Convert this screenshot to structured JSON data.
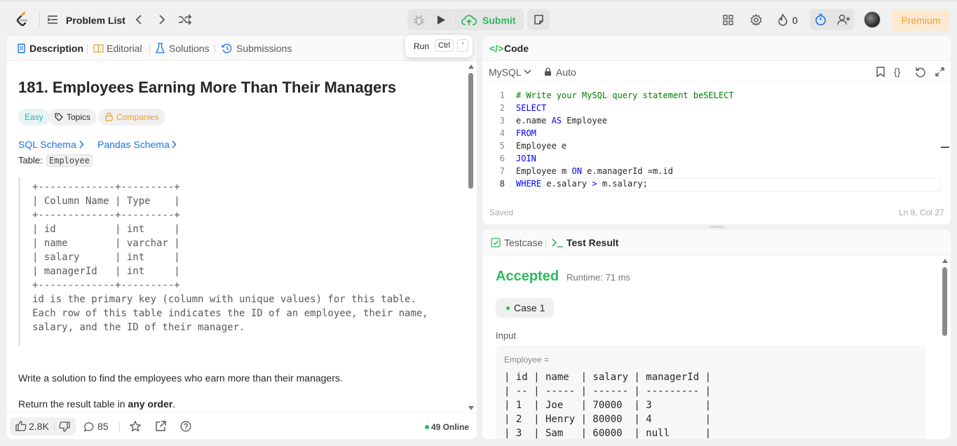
{
  "topbar": {
    "problem_list": "Problem List",
    "submit": "Submit",
    "streak": "0",
    "premium": "Premium"
  },
  "tooltip": {
    "run": "Run",
    "key1": "Ctrl",
    "key2": "'"
  },
  "left_tabs": [
    "Description",
    "Editorial",
    "Solutions",
    "Submissions"
  ],
  "problem": {
    "title": "181. Employees Earning More Than Their Managers",
    "difficulty": "Easy",
    "topics": "Topics",
    "companies": "Companies",
    "sql_schema": "SQL Schema",
    "pandas_schema": "Pandas Schema",
    "table_label": "Table:",
    "table_name": "Employee",
    "schema_lines": [
      "+-------------+---------+",
      "| Column Name | Type    |",
      "+-------------+---------+",
      "| id          | int     |",
      "| name        | varchar |",
      "| salary      | int     |",
      "| managerId   | int     |",
      "+-------------+---------+",
      "id is the primary key (column with unique values) for this table.",
      "Each row of this table indicates the ID of an employee, their name,",
      "salary, and the ID of their manager."
    ],
    "statement": "Write a solution to find the employees who earn more than their managers.",
    "return_prefix": "Return the result table in ",
    "return_bold": "any order",
    "return_suffix": "."
  },
  "footer": {
    "likes": "2.8K",
    "comments": "85",
    "online": "49 Online"
  },
  "code": {
    "tab": "Code",
    "language": "MySQL",
    "auto": "Auto",
    "saved": "Saved",
    "cursor": "Ln 8, Col 27",
    "line_numbers": [
      "1",
      "2",
      "3",
      "4",
      "5",
      "6",
      "7",
      "8"
    ]
  },
  "result": {
    "testcase_tab": "Testcase",
    "result_tab": "Test Result",
    "status": "Accepted",
    "runtime": "Runtime: 71 ms",
    "case": "Case 1",
    "input_label": "Input",
    "table_label": "Employee =",
    "lines": [
      "| id | name  | salary | managerId |",
      "| -- | ----- | ------ | --------- |",
      "| 1  | Joe   | 70000  | 3         |",
      "| 2  | Henry | 80000  | 4         |",
      "| 3  | Sam   | 60000  | null      |"
    ]
  },
  "colors": {
    "accent_green": "#2cbb5d",
    "link_blue": "#1a73e8",
    "premium_orange": "#f0a030"
  }
}
